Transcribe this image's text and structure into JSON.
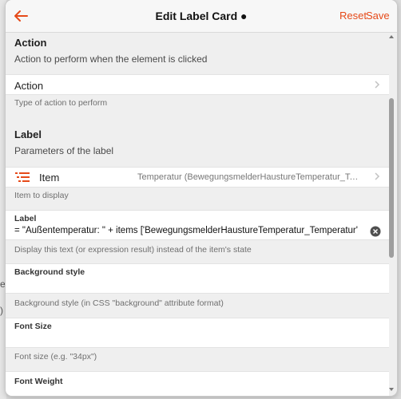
{
  "background": {
    "fragment_1": "e",
    "fragment_2": ")"
  },
  "navbar": {
    "back_icon": "arrow-left-icon",
    "title": "Edit Label Card ●",
    "reset_label": "Reset",
    "save_label": "Save",
    "accent_color": "#e64a19"
  },
  "action_section": {
    "title": "Action",
    "description": "Action to perform when the element is clicked"
  },
  "action_row": {
    "label": "Action",
    "info": "Type of action to perform"
  },
  "label_section": {
    "title": "Label",
    "description": "Parameters of the label"
  },
  "item_row": {
    "icon": "list-icon",
    "label": "Item",
    "value": "Temperatur (BewegungsmelderHaustureTemperatur_Temperatur)",
    "info": "Item to display"
  },
  "label_field": {
    "label": "Label",
    "value": "= \"Außentemperatur: \" + items ['BewegungsmelderHaustureTemperatur_Temperatur'].displayState",
    "info": "Display this text (or expression result) instead of the item's state"
  },
  "background_style_field": {
    "label": "Background style",
    "value": "",
    "info": "Background style (in CSS \"background\" attribute format)"
  },
  "font_size_field": {
    "label": "Font Size",
    "value": "",
    "info": "Font size (e.g. \"34px\")"
  },
  "font_weight_field": {
    "label": "Font Weight"
  }
}
